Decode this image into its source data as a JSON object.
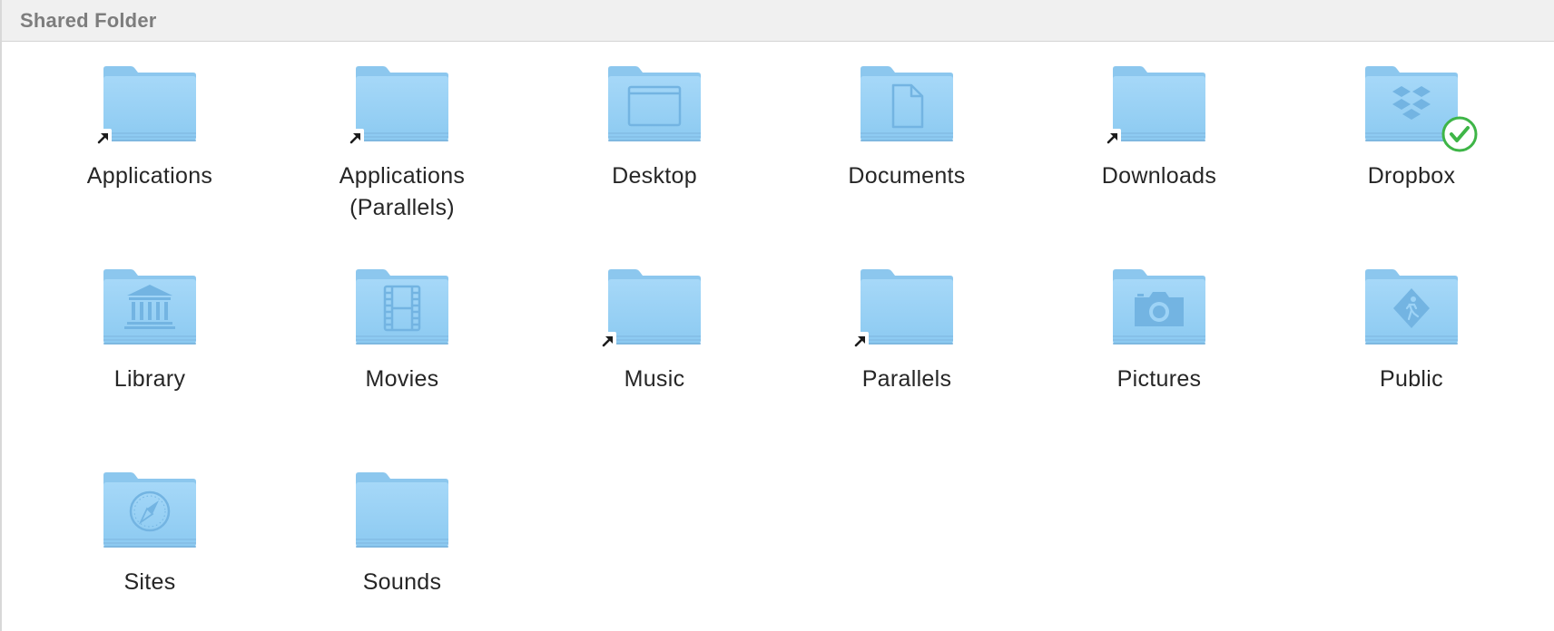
{
  "window": {
    "title": "Shared Folder"
  },
  "items": [
    {
      "label": "Applications",
      "glyph": "none",
      "alias": true,
      "badge": "none"
    },
    {
      "label": "Applications\n(Parallels)",
      "glyph": "none",
      "alias": true,
      "badge": "none"
    },
    {
      "label": "Desktop",
      "glyph": "desktop-window-icon",
      "alias": false,
      "badge": "none"
    },
    {
      "label": "Documents",
      "glyph": "document-page-icon",
      "alias": false,
      "badge": "none"
    },
    {
      "label": "Downloads",
      "glyph": "none",
      "alias": true,
      "badge": "none"
    },
    {
      "label": "Dropbox",
      "glyph": "dropbox-logo-icon",
      "alias": false,
      "badge": "sync-check-icon"
    },
    {
      "label": "Library",
      "glyph": "library-building-icon",
      "alias": false,
      "badge": "none"
    },
    {
      "label": "Movies",
      "glyph": "film-strip-icon",
      "alias": false,
      "badge": "none"
    },
    {
      "label": "Music",
      "glyph": "none",
      "alias": true,
      "badge": "none"
    },
    {
      "label": "Parallels",
      "glyph": "none",
      "alias": true,
      "badge": "none"
    },
    {
      "label": "Pictures",
      "glyph": "camera-icon",
      "alias": false,
      "badge": "none"
    },
    {
      "label": "Public",
      "glyph": "public-sign-icon",
      "alias": false,
      "badge": "none"
    },
    {
      "label": "Sites",
      "glyph": "compass-icon",
      "alias": false,
      "badge": "none"
    },
    {
      "label": "Sounds",
      "glyph": "none",
      "alias": false,
      "badge": "none"
    }
  ],
  "colors": {
    "folder_back": "#8cc7ee",
    "folder_front": "#9dd3f6",
    "folder_glyph": "#73b4e2",
    "badge_green": "#3eb547"
  }
}
